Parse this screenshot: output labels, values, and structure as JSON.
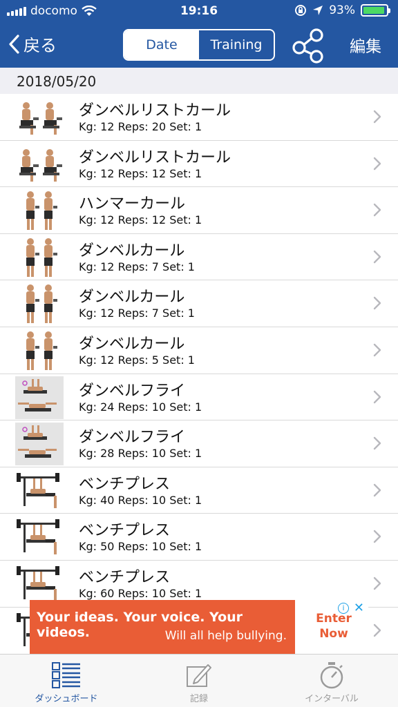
{
  "status": {
    "carrier": "docomo",
    "time": "19:16",
    "battery": "93%",
    "battery_level": 0.93
  },
  "nav": {
    "back_label": "戻る",
    "seg_date": "Date",
    "seg_training": "Training",
    "edit_label": "編集"
  },
  "section": {
    "date": "2018/05/20"
  },
  "list": [
    {
      "title": "ダンベルリストカール",
      "detail": "Kg: 12 Reps: 20 Set: 1",
      "thumb": "seated-figure"
    },
    {
      "title": "ダンベルリストカール",
      "detail": "Kg: 12 Reps: 12 Set: 1",
      "thumb": "seated-figure"
    },
    {
      "title": "ハンマーカール",
      "detail": "Kg: 12 Reps: 12 Set: 1",
      "thumb": "standing-figure"
    },
    {
      "title": "ダンベルカール",
      "detail": "Kg: 12 Reps: 7 Set: 1",
      "thumb": "standing-figure"
    },
    {
      "title": "ダンベルカール",
      "detail": "Kg: 12 Reps: 7 Set: 1",
      "thumb": "standing-figure"
    },
    {
      "title": "ダンベルカール",
      "detail": "Kg: 12 Reps: 5 Set: 1",
      "thumb": "standing-figure"
    },
    {
      "title": "ダンベルフライ",
      "detail": "Kg: 24 Reps: 10 Set: 1",
      "thumb": "bench-fly"
    },
    {
      "title": "ダンベルフライ",
      "detail": "Kg: 28 Reps: 10 Set: 1",
      "thumb": "bench-fly"
    },
    {
      "title": "ベンチプレス",
      "detail": "Kg: 40 Reps: 10 Set: 1",
      "thumb": "bench-press"
    },
    {
      "title": "ベンチプレス",
      "detail": "Kg: 50 Reps: 10 Set: 1",
      "thumb": "bench-press"
    },
    {
      "title": "ベンチプレス",
      "detail": "Kg: 60 Reps: 10 Set: 1",
      "thumb": "bench-press"
    },
    {
      "title": "",
      "detail": "",
      "thumb": "bench-press"
    }
  ],
  "ad": {
    "line1": "Your ideas. Your voice. Your videos.",
    "line2": "Will all help bullying.",
    "cta_line1": "Enter",
    "cta_line2": "Now"
  },
  "tabs": [
    {
      "label": "ダッシュボード",
      "icon": "dashboard-icon"
    },
    {
      "label": "記録",
      "icon": "pencil-icon"
    },
    {
      "label": "インターバル",
      "icon": "stopwatch-icon"
    }
  ],
  "colors": {
    "header": "#2457a2",
    "ad": "#e95d36",
    "active_tab": "#2457a2"
  }
}
